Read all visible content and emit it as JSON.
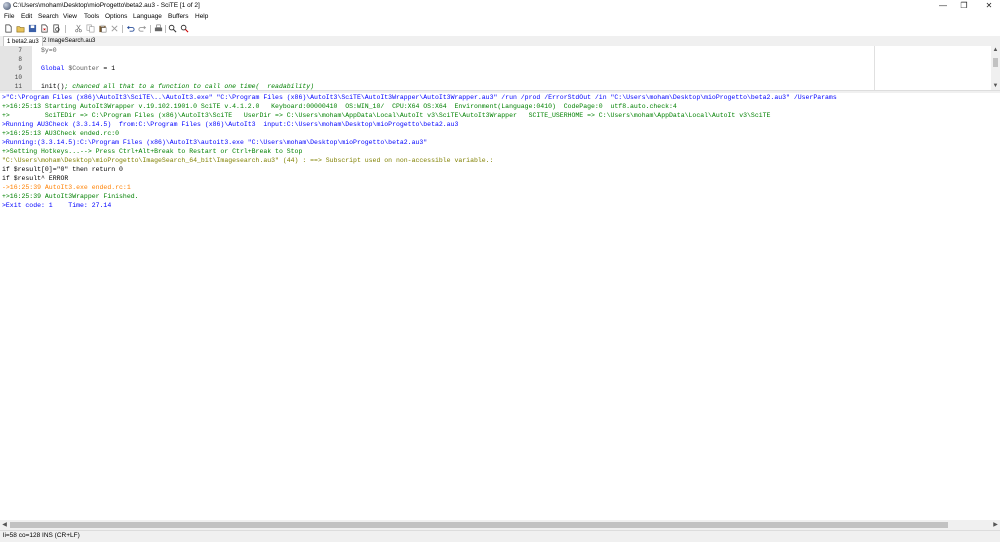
{
  "window": {
    "title": "C:\\Users\\moham\\Desktop\\mioProgetto\\beta2.au3 - SciTE [1 of 2]",
    "controls": {
      "minimize": "—",
      "maximize": "❐",
      "close": "✕"
    }
  },
  "menu": [
    "File",
    "Edit",
    "Search",
    "View",
    "Tools",
    "Options",
    "Language",
    "Buffers",
    "Help"
  ],
  "toolbar": {
    "icons": [
      "new-file-icon",
      "open-file-icon",
      "save-icon",
      "close-file-icon",
      "print-preview-icon",
      "cut-icon",
      "copy-icon",
      "paste-icon",
      "delete-icon",
      "undo-icon",
      "redo-icon",
      "print-icon",
      "find-icon",
      "find-replace-icon"
    ]
  },
  "tabs": [
    {
      "label": "1 beta2.au3",
      "active": true
    },
    {
      "label": "2 ImageSearch.au3",
      "active": false
    }
  ],
  "editor": {
    "lines": [
      {
        "num": "7",
        "text": "$y=0"
      },
      {
        "num": "8",
        "text": ""
      },
      {
        "num": "9",
        "kw": "Global ",
        "var": "$Counter",
        "rest": " = 1"
      },
      {
        "num": "10",
        "text": ""
      },
      {
        "num": "11",
        "code": "init()",
        "comment": "; chanced all that to a function to call one time(  readability)"
      }
    ]
  },
  "output": {
    "lines": [
      {
        "color": "#0000ff",
        "text": ">\"C:\\Program Files (x86)\\AutoIt3\\SciTE\\..\\AutoIt3.exe\" \"C:\\Program Files (x86)\\AutoIt3\\SciTE\\AutoIt3Wrapper\\AutoIt3Wrapper.au3\" /run /prod /ErrorStdOut /in \"C:\\Users\\moham\\Desktop\\mioProgetto\\beta2.au3\" /UserParams"
      },
      {
        "color": "#008000",
        "text": "+>16:25:13 Starting AutoIt3Wrapper v.19.102.1901.0 SciTE v.4.1.2.0   Keyboard:00000410  OS:WIN_10/  CPU:X64 OS:X64  Environment(Language:0410)  CodePage:0  utf8.auto.check:4"
      },
      {
        "color": "#008000",
        "text": "+>         SciTEDir => C:\\Program Files (x86)\\AutoIt3\\SciTE   UserDir => C:\\Users\\moham\\AppData\\Local\\AutoIt v3\\SciTE\\AutoIt3Wrapper   SCITE_USERHOME => C:\\Users\\moham\\AppData\\Local\\AutoIt v3\\SciTE"
      },
      {
        "color": "#0000ff",
        "text": ">Running AU3Check (3.3.14.5)  from:C:\\Program Files (x86)\\AutoIt3  input:C:\\Users\\moham\\Desktop\\mioProgetto\\beta2.au3"
      },
      {
        "color": "#008000",
        "text": "+>16:25:13 AU3Check ended.rc:0"
      },
      {
        "color": "#0000ff",
        "text": ">Running:(3.3.14.5):C:\\Program Files (x86)\\AutoIt3\\autoit3.exe \"C:\\Users\\moham\\Desktop\\mioProgetto\\beta2.au3\""
      },
      {
        "color": "#008000",
        "text": "+>Setting Hotkeys...--> Press Ctrl+Alt+Break to Restart or Ctrl+Break to Stop"
      },
      {
        "color": "#808000",
        "text": "\"C:\\Users\\moham\\Desktop\\mioProgetto\\ImageSearch_64_bit\\Imagesearch.au3\" (44) : ==> Subscript used on non-accessible variable.:"
      },
      {
        "color": "#000000",
        "text": "if $result[0]=\"0\" then return 0"
      },
      {
        "color": "#000000",
        "text": "if $result^ ERROR"
      },
      {
        "color": "#ff8000",
        "text": "->16:25:39 AutoIt3.exe ended.rc:1"
      },
      {
        "color": "#008000",
        "text": "+>16:25:39 AutoIt3Wrapper Finished."
      },
      {
        "color": "#0000ff",
        "text": ">Exit code: 1    Time: 27.14"
      }
    ]
  },
  "statusbar": {
    "text": "li=58 co=128 INS (CR+LF)"
  }
}
